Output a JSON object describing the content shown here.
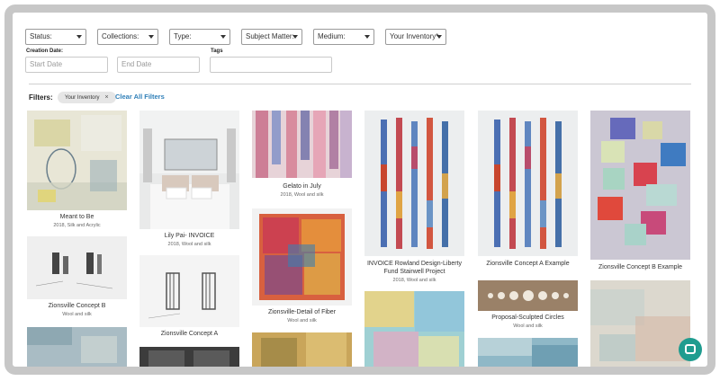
{
  "filters_row": {
    "status": "Status:",
    "collections": "Collections:",
    "type": "Type:",
    "subject_matter": "Subject Matter:",
    "medium": "Medium:",
    "your_inventory": "Your Inventory*"
  },
  "creation_date": {
    "label": "Creation Date:",
    "start_placeholder": "Start Date",
    "end_placeholder": "End Date"
  },
  "tags": {
    "label": "Tags",
    "value": ""
  },
  "active_filters": {
    "label": "Filters:",
    "chips": [
      "Your Inventory"
    ],
    "clear_label": "Clear All Filters"
  },
  "artworks": [
    {
      "title": "Meant to Be",
      "subtitle": "2018, Silk and Acrylic"
    },
    {
      "title": "Zionsville Concept B",
      "subtitle": "Wool and silk"
    },
    {
      "title": "Lily Pai- INVOICE",
      "subtitle": "2018, Wool and silk"
    },
    {
      "title": "Zionsville Concept A",
      "subtitle": ""
    },
    {
      "title": "Gelato in July",
      "subtitle": "2018, Wool and silk"
    },
    {
      "title": "Zionsville-Detail of Fiber",
      "subtitle": "Wool and silk"
    },
    {
      "title": "INVOICE Rowland Design-Liberty Fund Stairwell Project",
      "subtitle": "2018, Wool and silk"
    },
    {
      "title": "Zionsville Concept A Example",
      "subtitle": ""
    },
    {
      "title": "Proposal-Sculpted Circles",
      "subtitle": "Wool and silk"
    },
    {
      "title": "Zionsville Concept B Example",
      "subtitle": ""
    }
  ],
  "colors": {
    "accent": "#2f7fb8",
    "chat": "#1f9c8f"
  }
}
